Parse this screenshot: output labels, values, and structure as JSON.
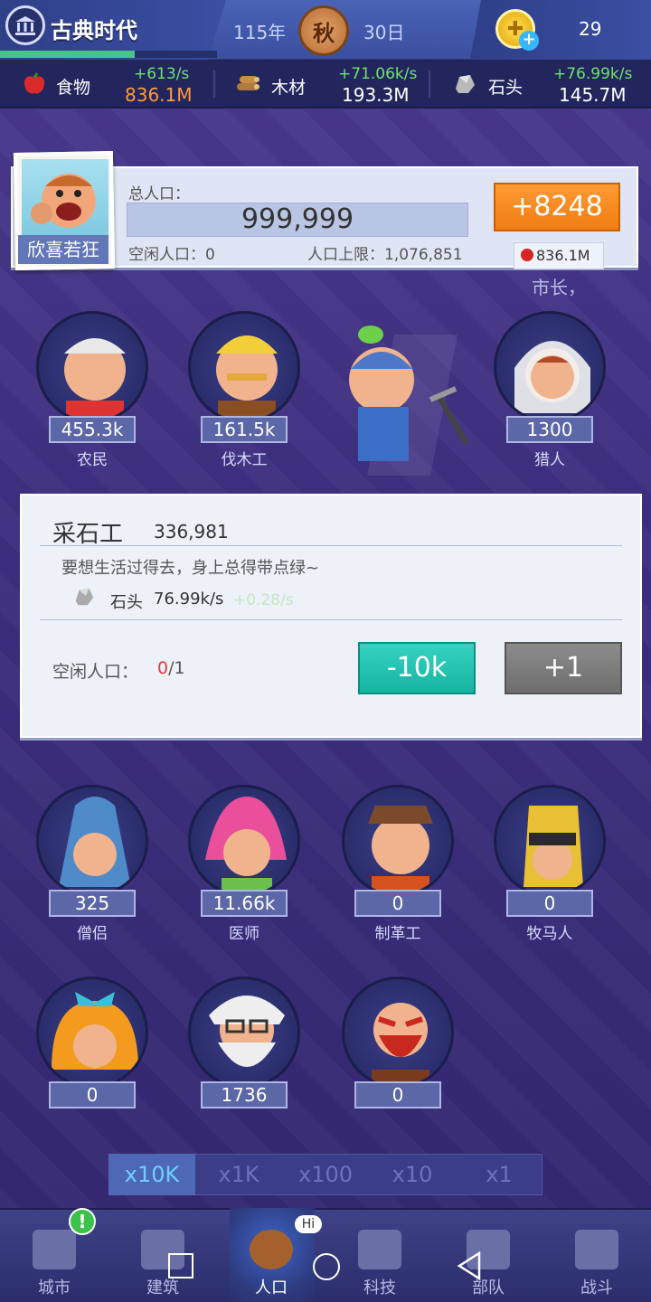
{
  "header": {
    "era_title": "古典时代",
    "year": "115年",
    "season": "秋",
    "day": "30日",
    "coins": "29",
    "era_progress": 0.62
  },
  "resources": [
    {
      "name": "食物",
      "rate": "+613/s",
      "amount": "836.1M",
      "amount_color": "#ff9a3c",
      "icon": "apple-icon"
    },
    {
      "name": "木材",
      "rate": "+71.06k/s",
      "amount": "193.3M",
      "amount_color": "#ffffff",
      "icon": "wood-icon"
    },
    {
      "name": "石头",
      "rate": "+76.99k/s",
      "amount": "145.7M",
      "amount_color": "#ffffff",
      "icon": "stone-icon"
    }
  ],
  "population": {
    "portrait_label": "欣喜若狂",
    "total_label": "总人口：",
    "total": "999,999",
    "idle_label": "空闲人口：",
    "idle": "0",
    "cap_label": "人口上限：",
    "cap": "1,076,851",
    "add_button": "+8248",
    "cost": "836.1M"
  },
  "mayor_text": "市长，",
  "jobs_top": [
    {
      "name": "农民",
      "count": "455.3k"
    },
    {
      "name": "伐木工",
      "count": "161.5k"
    },
    {
      "name": "采石工",
      "count": ""
    },
    {
      "name": "猎人",
      "count": "1300"
    }
  ],
  "panel": {
    "title": "采石工",
    "count": "336,981",
    "quote": "要想生活过得去，身上总得带点绿~",
    "prod_name": "石头",
    "prod_rate": "76.99k/s",
    "prod_bonus": "+0.28/s",
    "idle_label": "空闲人口：",
    "idle_current": "0",
    "idle_total": "/1",
    "minus_button": "-10k",
    "plus_button": "+1"
  },
  "jobs_bottom": [
    {
      "name": "僧侣",
      "count": "325"
    },
    {
      "name": "医师",
      "count": "11.66k"
    },
    {
      "name": "制革工",
      "count": "0"
    },
    {
      "name": "牧马人",
      "count": "0"
    },
    {
      "name": "",
      "count": "0"
    },
    {
      "name": "",
      "count": "1736"
    },
    {
      "name": "",
      "count": "0"
    }
  ],
  "multipliers": [
    "x10K",
    "x1K",
    "x100",
    "x10",
    "x1"
  ],
  "selected_multiplier": "x10K",
  "nav": [
    {
      "label": "城市",
      "icon": "castle-icon"
    },
    {
      "label": "建筑",
      "icon": "house-icon"
    },
    {
      "label": "人口",
      "icon": "person-icon"
    },
    {
      "label": "科技",
      "icon": "book-icon"
    },
    {
      "label": "部队",
      "icon": "tower-icon"
    },
    {
      "label": "战斗",
      "icon": "swords-icon"
    }
  ],
  "nav_alert": "!",
  "nav_hi": "Hi",
  "colors": {
    "accent_orange": "#f07d12",
    "accent_teal": "#17b3a2",
    "rate_green": "#6fe36f"
  }
}
